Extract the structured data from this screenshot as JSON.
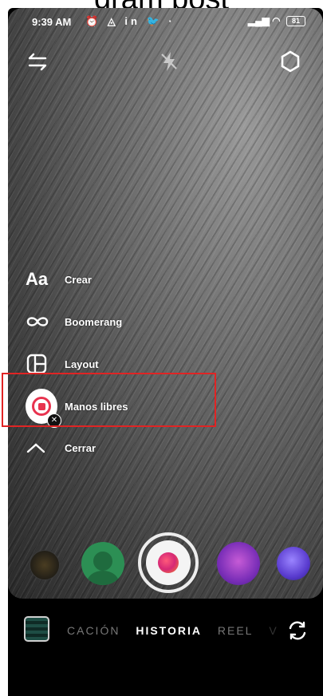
{
  "page": {
    "heading": "gram post"
  },
  "status_bar": {
    "time": "9:39 AM",
    "left_icons": [
      "alarm-icon",
      "drive-icon",
      "linkedin-icon",
      "twitter-icon"
    ],
    "left_icons_text": "⏰ ◬ in 🐦 ·",
    "right_icons": [
      "signal-icon",
      "wifi-icon",
      "battery-icon"
    ],
    "battery": "81"
  },
  "menu": {
    "items": [
      {
        "label": "Crear",
        "icon": "text-aa-icon",
        "glyph": "Aa"
      },
      {
        "label": "Boomerang",
        "icon": "infinity-icon"
      },
      {
        "label": "Layout",
        "icon": "layout-icon"
      },
      {
        "label": "Manos libres",
        "icon": "hands-free-icon",
        "highlighted": true
      },
      {
        "label": "Cerrar",
        "icon": "chevron-up-icon"
      }
    ],
    "close_badge": "✕"
  },
  "modes": {
    "tabs": [
      "CACIÓN",
      "HISTORIA",
      "REEL",
      "V"
    ],
    "active": "HISTORIA"
  },
  "colors": {
    "highlight": "#e02424",
    "record": "#e8334f"
  }
}
